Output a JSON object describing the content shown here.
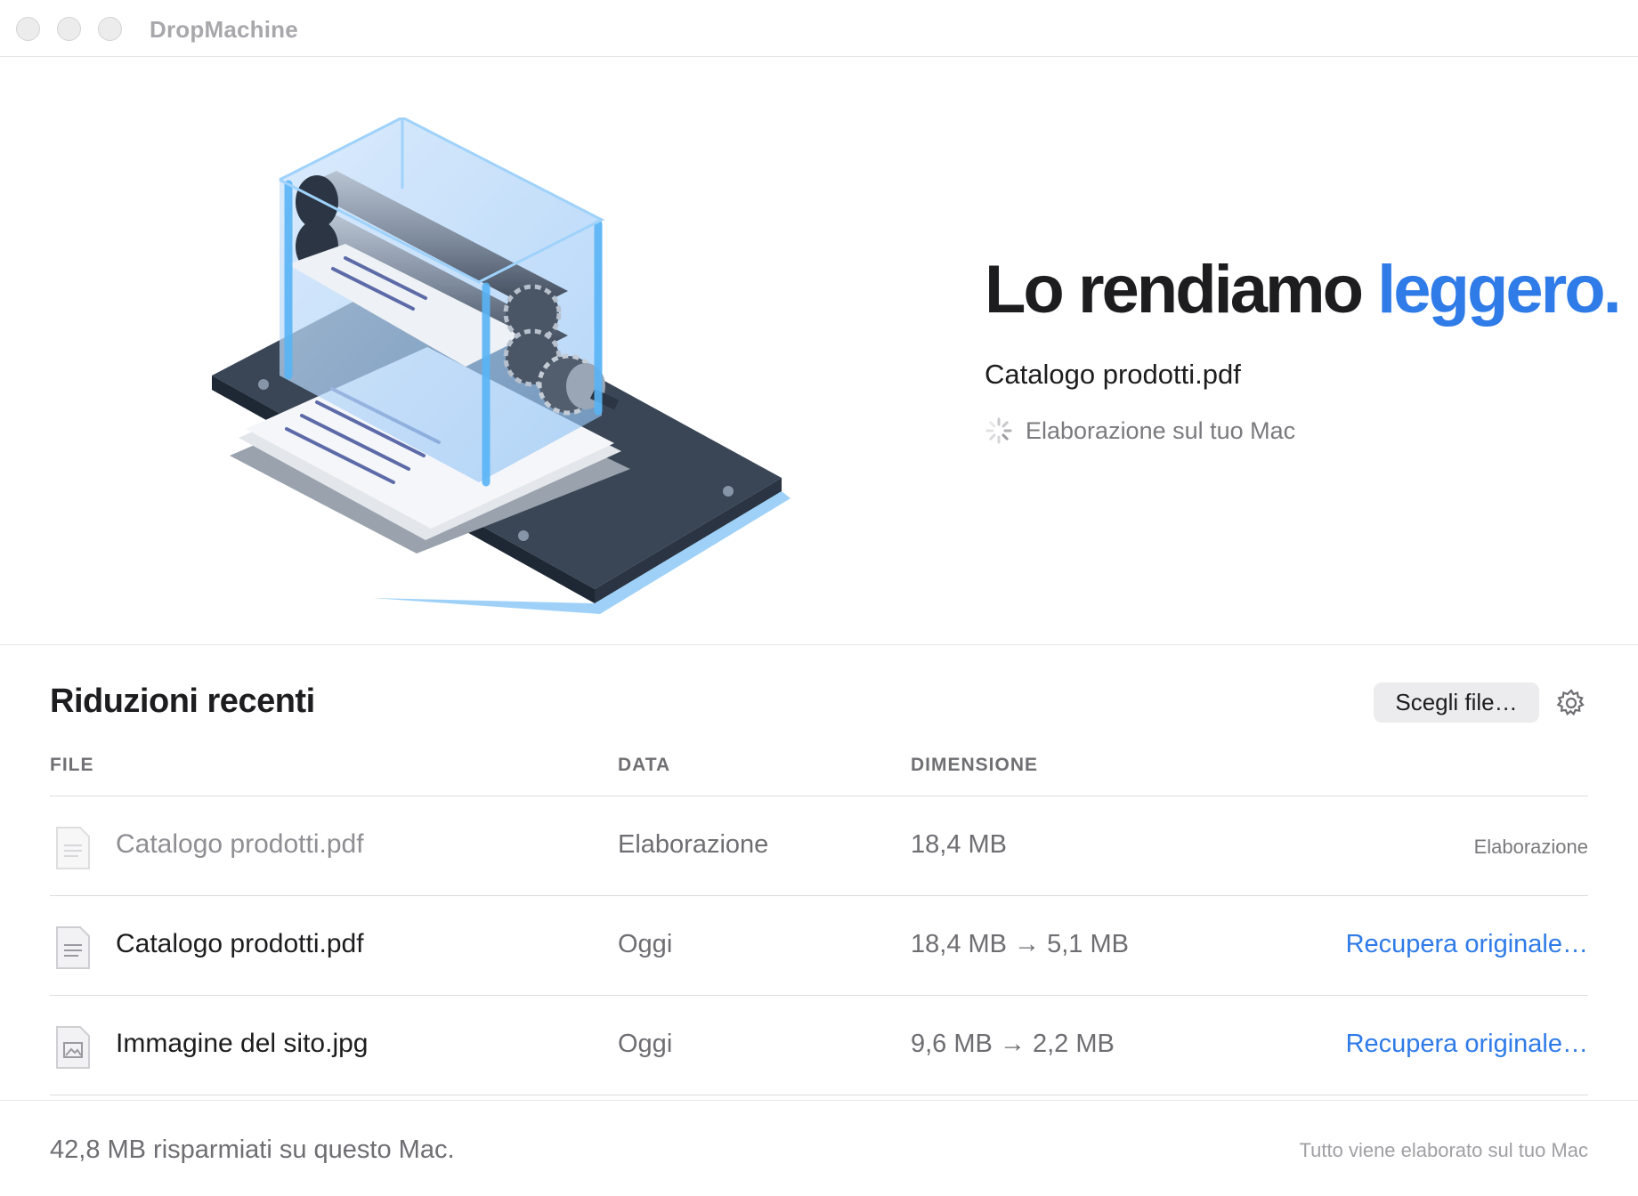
{
  "window": {
    "title": "DropMachine"
  },
  "hero": {
    "headline_main": "Lo rendiamo",
    "headline_accent": "leggero.",
    "current_file": "Catalogo prodotti.pdf",
    "status": "Elaborazione sul tuo Mac",
    "accent_color": "#2f7be8"
  },
  "recent": {
    "title": "Riduzioni recenti",
    "choose_button": "Scegli file…",
    "columns": {
      "file": "FILE",
      "date": "DATA",
      "size": "DIMENSIONE"
    },
    "rows": [
      {
        "name": "Catalogo prodotti.pdf",
        "date": "Elaborazione",
        "size": "18,4 MB",
        "action": "Elaborazione",
        "icon": "pdf-document-icon",
        "state": "processing"
      },
      {
        "name": "Catalogo prodotti.pdf",
        "date": "Oggi",
        "size": "18,4 MB → 5,1 MB",
        "action": "Recupera originale…",
        "icon": "pdf-document-icon",
        "state": "done"
      },
      {
        "name": "Immagine del sito.jpg",
        "date": "Oggi",
        "size": "9,6 MB → 2,2 MB",
        "action": "Recupera originale…",
        "icon": "image-file-icon",
        "state": "done"
      }
    ]
  },
  "footer": {
    "saved": "42,8 MB risparmiati su questo Mac.",
    "note": "Tutto viene elaborato sul tuo Mac"
  }
}
